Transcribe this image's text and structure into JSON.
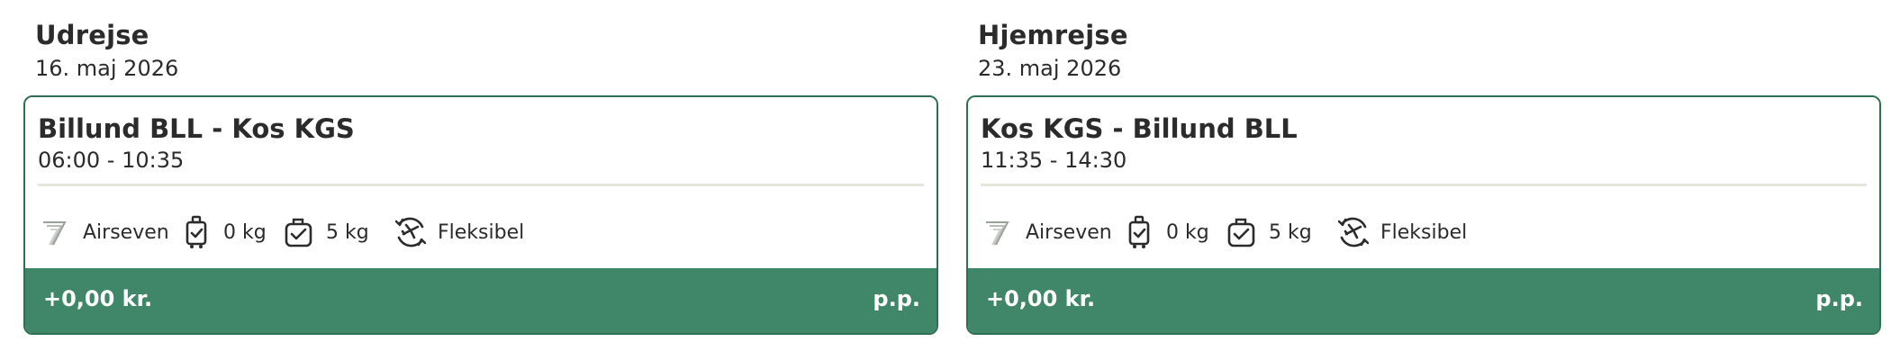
{
  "outbound": {
    "heading": "Udrejse",
    "date": "16. maj 2026",
    "route": "Billund BLL - Kos KGS",
    "times": "06:00 - 10:35",
    "airline": "Airseven",
    "carry_on": "0 kg",
    "checked": "5 kg",
    "flex": "Fleksibel",
    "price": "+0,00 kr.",
    "per_person": "p.p."
  },
  "return": {
    "heading": "Hjemrejse",
    "date": "23. maj 2026",
    "route": "Kos KGS - Billund BLL",
    "times": "11:35 - 14:30",
    "airline": "Airseven",
    "carry_on": "0 kg",
    "checked": "5 kg",
    "flex": "Fleksibel",
    "price": "+0,00 kr.",
    "per_person": "p.p."
  },
  "icons": {
    "airline": "airseven-logo-icon",
    "carry_on": "carry-on-bag-icon",
    "checked": "checked-bag-icon",
    "flex": "flexible-ticket-icon"
  },
  "colors": {
    "accent": "#3f8768",
    "border": "#2e6e52",
    "divider": "#e6e6dc",
    "text": "#2b2b2b"
  }
}
